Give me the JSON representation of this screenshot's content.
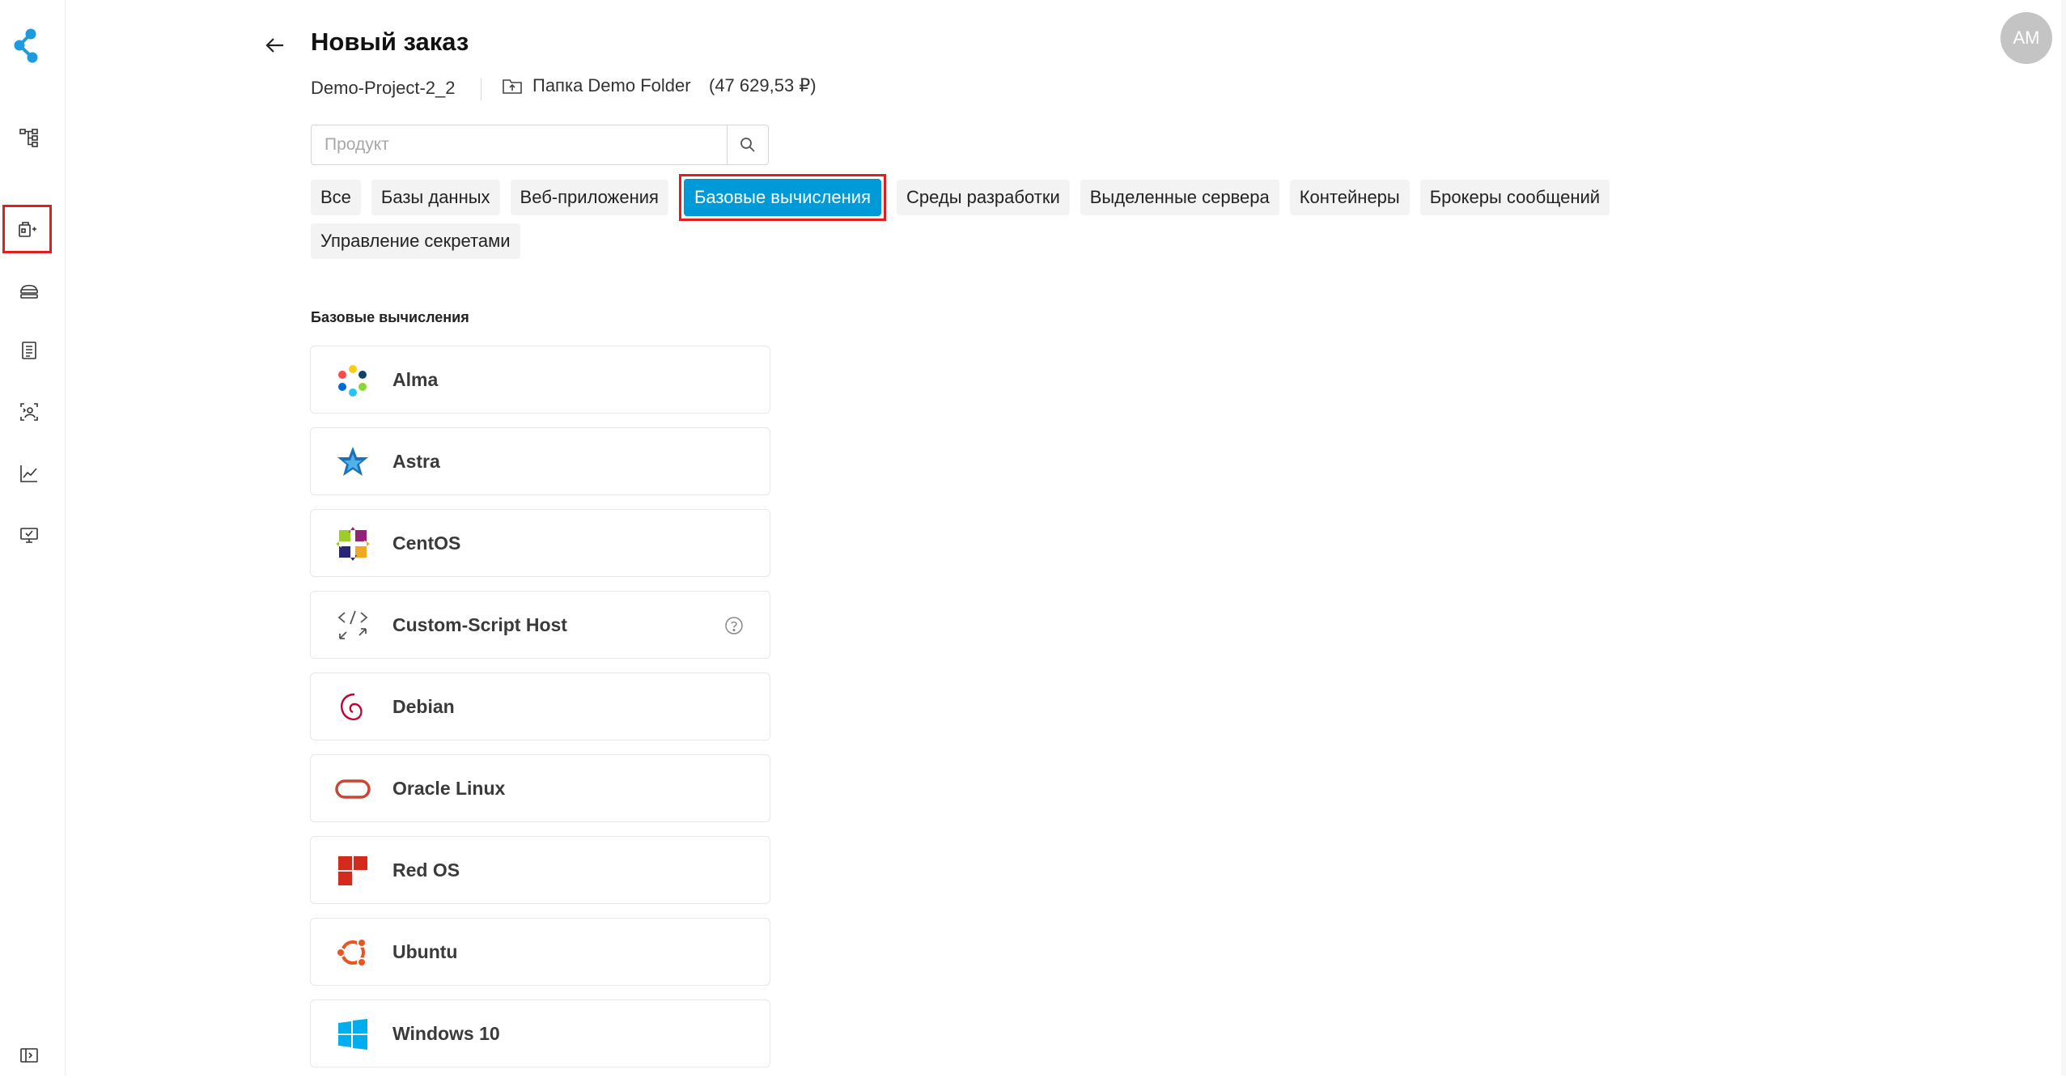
{
  "header": {
    "title": "Новый заказ",
    "project": "Demo-Project-2_2",
    "folder_label": "Папка Demo Folder",
    "folder_sum": "(47 629,53 ₽)"
  },
  "user": {
    "initials": "AM"
  },
  "search": {
    "placeholder": "Продукт",
    "value": ""
  },
  "tabs": {
    "row1": [
      "Все",
      "Базы данных",
      "Веб-приложения",
      "Базовые вычисления",
      "Среды разработки",
      "Выделенные сервера",
      "Контейнеры",
      "Брокеры сообщений"
    ],
    "row2": [
      "Управление секретами"
    ],
    "active": "Базовые вычисления"
  },
  "section": {
    "title": "Базовые вычисления"
  },
  "products": [
    {
      "name": "Alma",
      "icon": "alma-logo-icon"
    },
    {
      "name": "Astra",
      "icon": "astra-logo-icon"
    },
    {
      "name": "CentOS",
      "icon": "centos-logo-icon"
    },
    {
      "name": "Custom-Script Host",
      "icon": "code-icon",
      "help": true
    },
    {
      "name": "Debian",
      "icon": "debian-logo-icon"
    },
    {
      "name": "Oracle Linux",
      "icon": "oracle-logo-icon"
    },
    {
      "name": "Red OS",
      "icon": "redos-logo-icon"
    },
    {
      "name": "Ubuntu",
      "icon": "ubuntu-logo-icon"
    },
    {
      "name": "Windows 10",
      "icon": "windows-logo-icon"
    }
  ],
  "colors": {
    "accent": "#009ad9",
    "highlight_border": "#e11d1d",
    "tab_bg": "#f3f3f3",
    "avatar_bg": "#c4c4c4"
  },
  "sidebar": {
    "icons": [
      "app-logo-icon",
      "structure-icon",
      "order-icon",
      "storage-icon",
      "checklist-icon",
      "user-access-icon",
      "analytics-icon",
      "monitor-icon",
      "expand-sidebar-icon"
    ]
  }
}
